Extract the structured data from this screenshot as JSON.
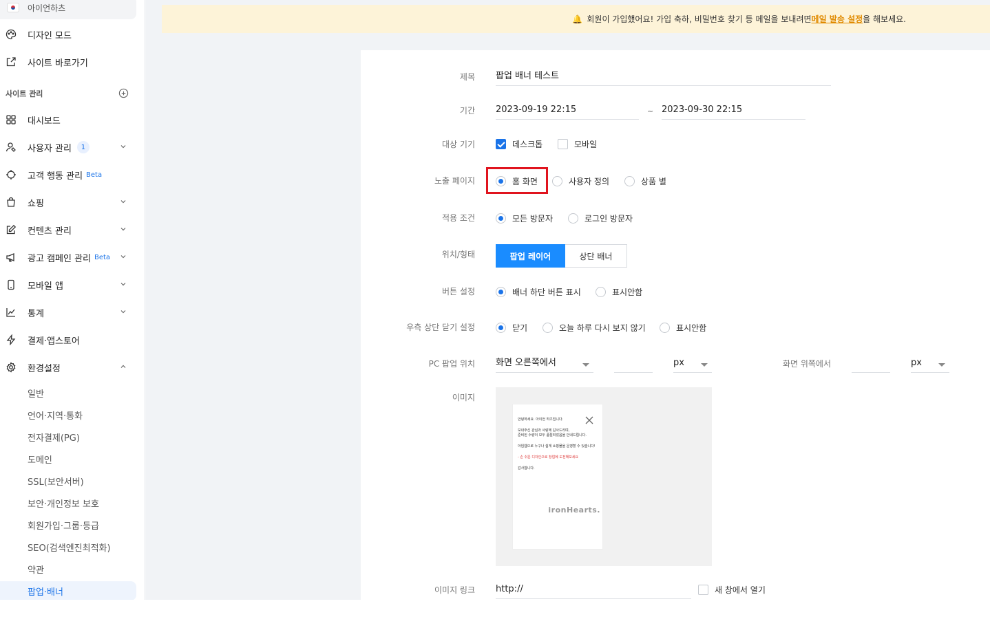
{
  "sidebar": {
    "site_name": "아이언하츠",
    "top_items": [
      {
        "label": "디자인 모드",
        "icon": "palette-icon"
      },
      {
        "label": "사이트 바로가기",
        "icon": "external-link-icon"
      }
    ],
    "section_title": "사이트 관리",
    "items": [
      {
        "label": "대시보드",
        "icon": "grid-icon"
      },
      {
        "label": "사용자 관리",
        "icon": "user-icon",
        "badge": "1"
      },
      {
        "label": "고객 행동 관리",
        "icon": "crosshair-icon",
        "beta": "Beta"
      },
      {
        "label": "쇼핑",
        "icon": "bag-icon"
      },
      {
        "label": "컨텐츠 관리",
        "icon": "edit-icon"
      },
      {
        "label": "광고 캠페인 관리",
        "icon": "megaphone-icon",
        "beta": "Beta"
      },
      {
        "label": "모바일 앱",
        "icon": "mobile-icon"
      },
      {
        "label": "통계",
        "icon": "chart-icon"
      },
      {
        "label": "결제·앱스토어",
        "icon": "bolt-icon"
      },
      {
        "label": "환경설정",
        "icon": "gear-icon"
      }
    ],
    "sub_items": [
      "일반",
      "언어·지역·통화",
      "전자결제(PG)",
      "도메인",
      "SSL(보안서버)",
      "보안·개인정보 보호",
      "회원가입·그룹·등급",
      "SEO(검색엔진최적화)",
      "약관",
      "팝업·배너"
    ]
  },
  "notice": {
    "text_before": "회원이 가입했어요! 가입 축하, 비밀번호 찾기 등 메일을 보내려면 ",
    "link": "메일 발송 설정",
    "text_after": "을 해보세요."
  },
  "form": {
    "title_label": "제목",
    "title_value": "팝업 배너 테스트",
    "period_label": "기간",
    "period_start": "2023-09-19 22:15",
    "period_sep": "~",
    "period_end": "2023-09-30 22:15",
    "device_label": "대상 기기",
    "device_desktop": "데스크톱",
    "device_mobile": "모바일",
    "page_label": "노출 페이지",
    "page_home": "홈 화면",
    "page_custom": "사용자 정의",
    "page_product": "상품 별",
    "cond_label": "적용 조건",
    "cond_all": "모든 방문자",
    "cond_login": "로그인 방문자",
    "pos_label": "위치/형태",
    "pos_popup": "팝업 레이어",
    "pos_banner": "상단 배너",
    "btn_label": "버튼 설정",
    "btn_show": "배너 하단 버튼 표시",
    "btn_hide": "표시안함",
    "close_label": "우측 상단 닫기 설정",
    "close_close": "닫기",
    "close_today": "오늘 하루 다시 보지 않기",
    "close_hide": "표시안함",
    "pcpos_label": "PC 팝업 위치",
    "pcpos_value": "화면 오른쪽에서",
    "pcpos_unit": "px",
    "pcpos_top_label": "화면 위쪽에서",
    "pcpos_top_unit": "px",
    "image_label": "이미지",
    "link_label": "이미지 링크",
    "link_value": "http://",
    "link_newwin": "새 창에서 열기"
  },
  "popup_preview": {
    "line1": "안녕하세요. 아이언 하츠입니다.",
    "line2": "보내주신 관심과 사랑에 감사드리며,",
    "line3": "준비된 수량이 모두 품절되었음을 안내드립니다.",
    "line4": "아임웹으로 누구나 쉽게 쇼핑몰을 운영할 수 있습니다!",
    "line5": "- 손 쉬운 디자인으로 창업에 도전해보세요",
    "line6": "감사합니다.",
    "brand": "ironHearts."
  },
  "colors": {
    "accent": "#1a73e8",
    "primary_button": "#1a8cff",
    "highlight": "#e0141e",
    "notice_bg": "#fdf3d8",
    "notice_link": "#e08a00"
  }
}
